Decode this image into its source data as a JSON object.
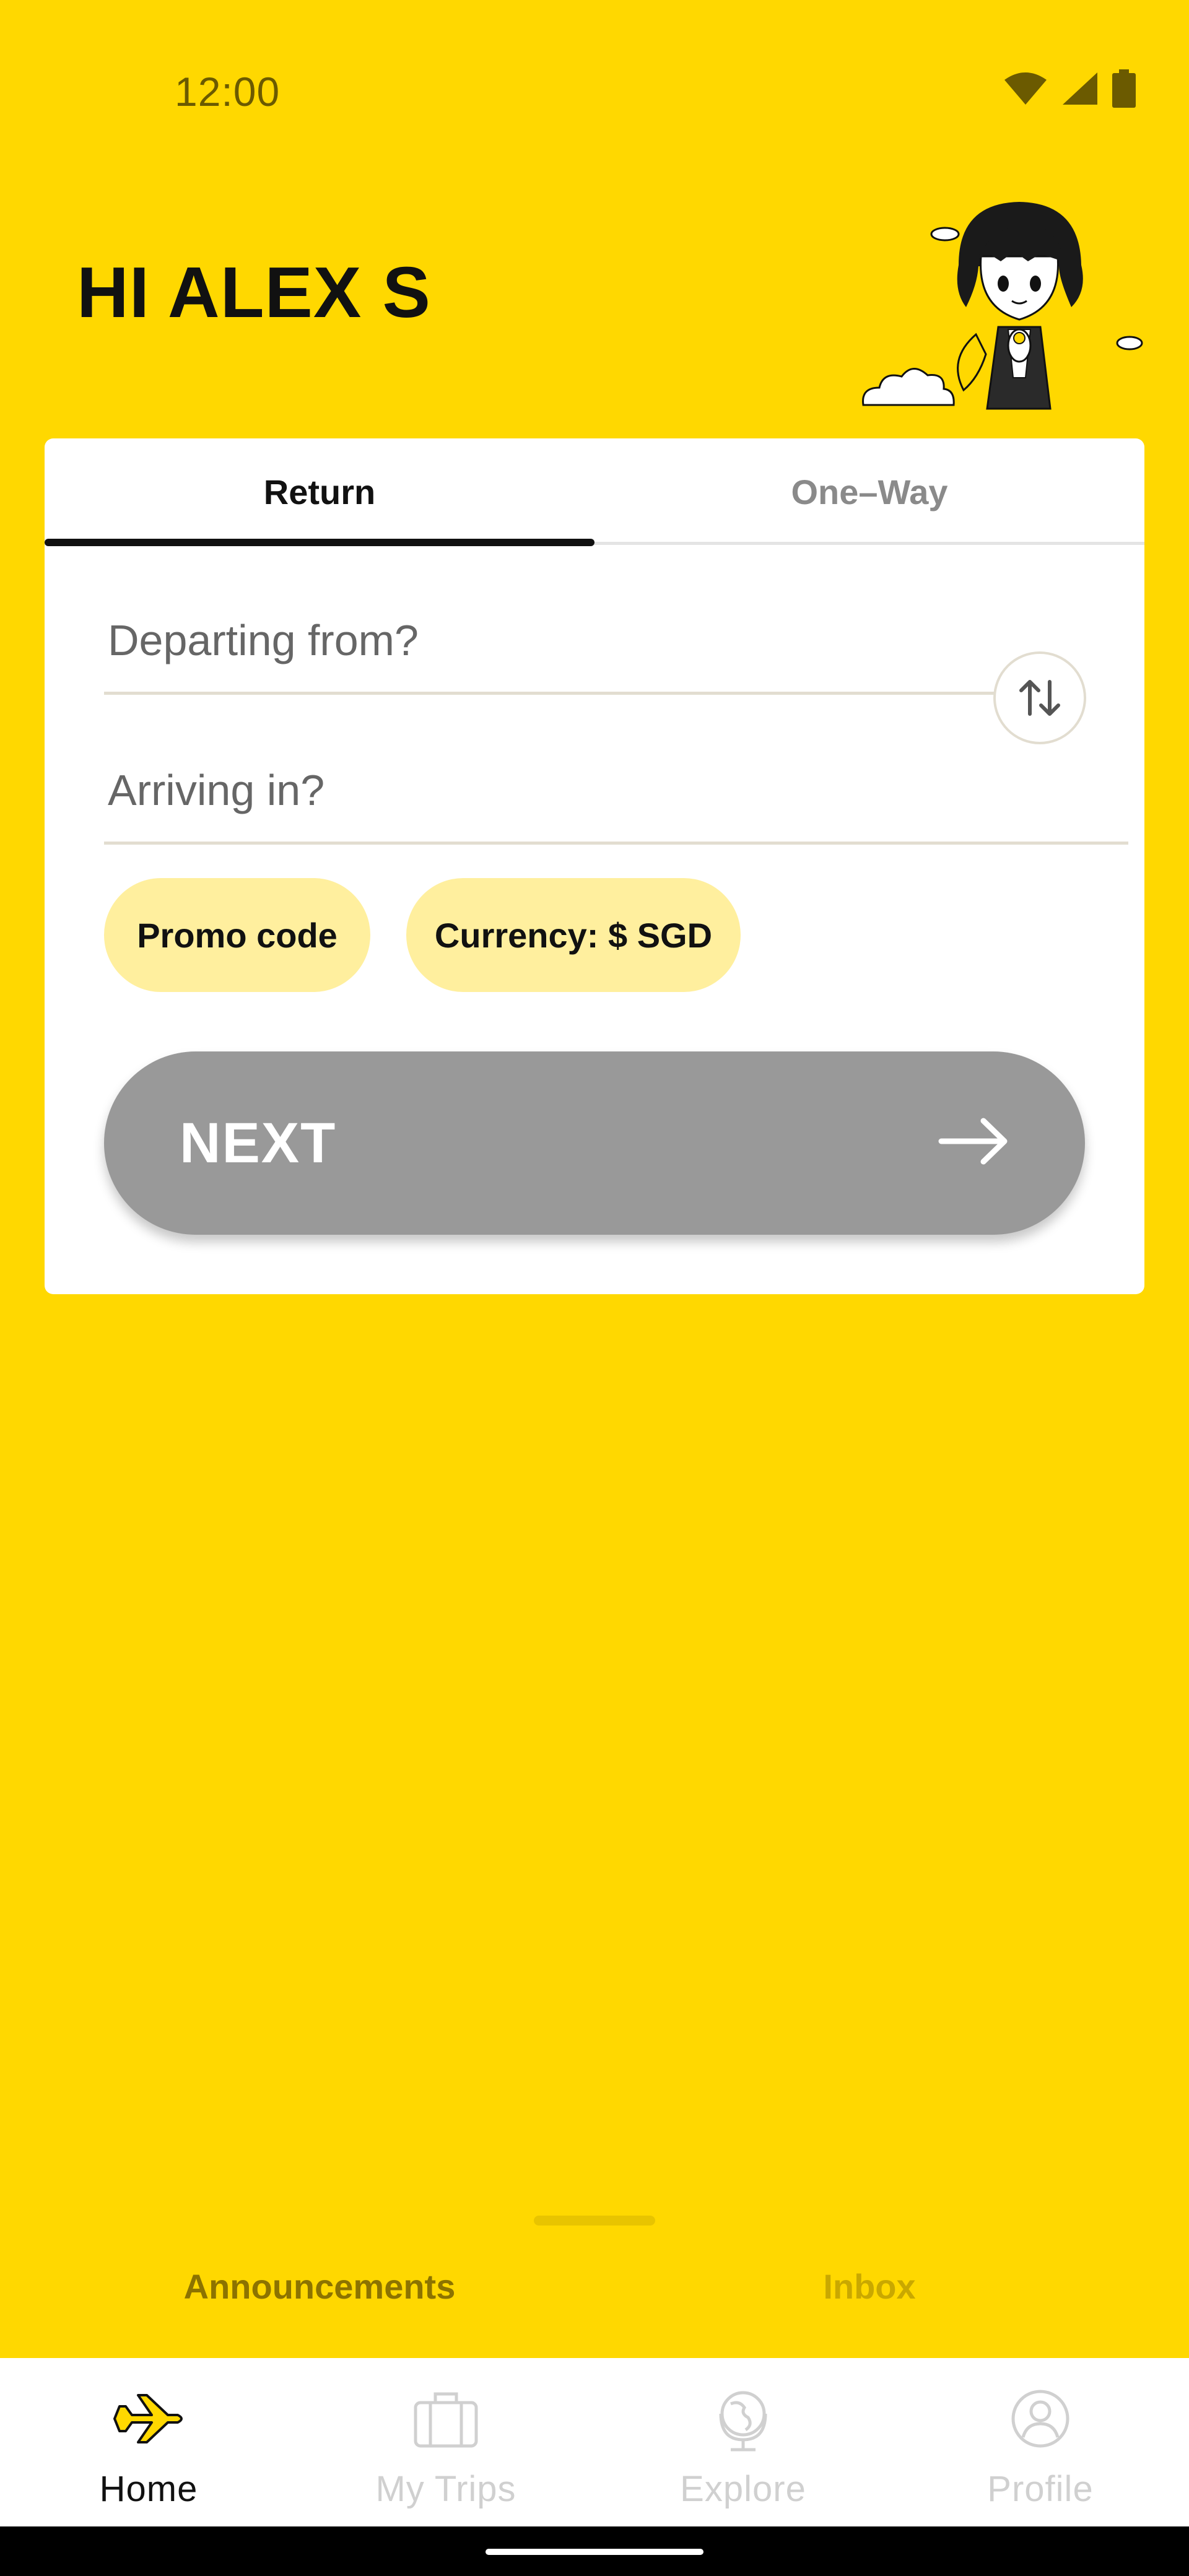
{
  "status_bar": {
    "time": "12:00"
  },
  "header": {
    "greeting": "HI ALEX S"
  },
  "booking": {
    "tabs": [
      {
        "label": "Return",
        "selected": true
      },
      {
        "label": "One–Way",
        "selected": false
      }
    ],
    "departing_placeholder": "Departing from?",
    "arriving_placeholder": "Arriving in?",
    "promo_chip": "Promo code",
    "currency_chip": "Currency: $ SGD",
    "next_label": "NEXT"
  },
  "sheet": {
    "tabs": [
      {
        "label": "Announcements"
      },
      {
        "label": "Inbox"
      }
    ]
  },
  "bottom_nav": {
    "items": [
      {
        "label": "Home",
        "icon": "airplane-icon",
        "active": true
      },
      {
        "label": "My Trips",
        "icon": "suitcase-icon",
        "active": false
      },
      {
        "label": "Explore",
        "icon": "globe-icon",
        "active": false
      },
      {
        "label": "Profile",
        "icon": "person-icon",
        "active": false
      }
    ]
  },
  "colors": {
    "background": "#FFD800",
    "chip": "#FFEF9E",
    "next_disabled": "#999999",
    "text_dark": "#111111"
  }
}
